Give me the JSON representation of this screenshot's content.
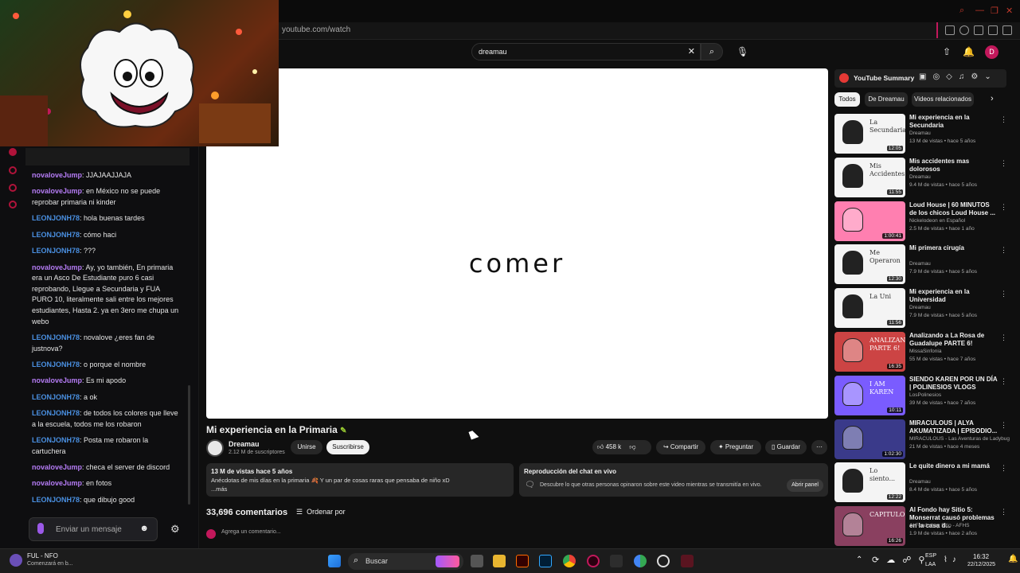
{
  "browser": {
    "url": "youtube.com/watch"
  },
  "youtube": {
    "search_query": "dreamau",
    "avatar_letter": "D",
    "player_word": "comer",
    "video_title": "Mi experiencia en la Primaria",
    "channel_name": "Dreamau",
    "channel_subs": "2.12 M de suscriptores",
    "join_label": "Unirse",
    "subscribe_label": "Suscribirse",
    "likes": "458 k",
    "share_label": "Compartir",
    "ask_label": "Preguntar",
    "save_label": "Guardar",
    "desc_stats": "13 M de vistas  hace 5 años",
    "desc_text": "Anécdotas de mis días en la primaria 🍂 Y un par de cosas raras que pensaba de niño xD",
    "desc_more": "...más",
    "live_title": "Reproducción del chat en vivo",
    "live_desc": "Descubre lo que otras personas opinaron sobre este video mientras se transmitía en vivo.",
    "live_button": "Abrir panel",
    "comment_count": "33,696 comentarios",
    "order_label": "Ordenar por",
    "add_comment_placeholder": "Agrega un comentario..."
  },
  "sidebar": {
    "summary_title": "YouTube Summary",
    "chips": [
      "Todos",
      "De Dreamau",
      "Videos relacionados"
    ],
    "videos": [
      {
        "title": "Mi experiencia en la Secundaria",
        "channel": "Dreamau",
        "views": "13 M de vistas • hace 5 años",
        "duration": "12:05",
        "thumb_text": "La Secundaria"
      },
      {
        "title": "Mis accidentes mas dolorosos",
        "channel": "Dreamau",
        "views": "9.4 M de vistas • hace 5 años",
        "duration": "11:55",
        "thumb_text": "Mis Accidentes"
      },
      {
        "title": "Loud House | 60 MINUTOS de los chicos Loud House ...",
        "channel": "Nickelodeon en Español",
        "views": "2.5 M de vistas • hace 1 año",
        "duration": "1:00:41",
        "thumb_text": ""
      },
      {
        "title": "Mi primera cirugía",
        "channel": "Dreamau",
        "views": "7.9 M de vistas • hace 5 años",
        "duration": "12:30",
        "thumb_text": "Me Operaron"
      },
      {
        "title": "Mi experiencia en la Universidad",
        "channel": "Dreamau",
        "views": "7.9 M de vistas • hace 5 años",
        "duration": "11:56",
        "thumb_text": "La Uni"
      },
      {
        "title": "Analizando a La Rosa de Guadalupe PARTE 6!",
        "channel": "MissaSinfonia",
        "views": "55 M de vistas • hace 7 años",
        "duration": "16:35",
        "thumb_text": "ANALIZANDO PARTE 6!"
      },
      {
        "title": "SIENDO KAREN POR UN DÍA | POLINESIOS VLOGS",
        "channel": "LosPolinesios",
        "views": "39 M de vistas • hace 7 años",
        "duration": "10:11",
        "thumb_text": "I AM KAREN"
      },
      {
        "title": "MIRACULOUS | ALYA AKUMATIZADA | EPISODIO...",
        "channel": "MIRACULOUS - Las Aventuras de Ladybug",
        "views": "21 M de vistas • hace 4 meses",
        "duration": "1:02:30",
        "thumb_text": ""
      },
      {
        "title": "Le quite dinero a mi mamá",
        "channel": "Dreamau",
        "views": "8.4 M de vistas • hace 5 años",
        "duration": "12:22",
        "thumb_text": "Lo siento..."
      },
      {
        "title": "Al Fondo hay Sitio 5: Monserrat causó problemas en la casa d...",
        "channel": "Al Fondo hay Sitio - AFHS",
        "views": "1.9 M de vistas • hace 2 años",
        "duration": "16:26",
        "thumb_text": "CAPITULO"
      }
    ]
  },
  "chat": {
    "messages": [
      {
        "user": "novaloveJump",
        "text": "JJAJAAJJAJA",
        "color": "#b57cf5"
      },
      {
        "user": "novaloveJump",
        "text": "en México no se puede reprobar primaria ni kinder",
        "color": "#b57cf5"
      },
      {
        "user": "LEONJONH78",
        "text": "hola buenas tardes",
        "color": "#4a90e2"
      },
      {
        "user": "LEONJONH78",
        "text": "cómo haci",
        "color": "#4a90e2"
      },
      {
        "user": "LEONJONH78",
        "text": "???",
        "color": "#4a90e2"
      },
      {
        "user": "novaloveJump",
        "text": "Ay, yo también, En primaria era un Asco De Estudiante puro 6 casi reprobando, Llegue a Secundaria y FUA PURO 10, literalmente sali entre los mejores estudiantes, Hasta 2. ya en 3ero me chupa un webo",
        "color": "#b57cf5"
      },
      {
        "user": "LEONJONH78",
        "text": "novalove ¿eres fan de justnova?",
        "color": "#4a90e2"
      },
      {
        "user": "LEONJONH78",
        "text": "o porque el nombre",
        "color": "#4a90e2"
      },
      {
        "user": "novaloveJump",
        "text": "Es mi apodo",
        "color": "#b57cf5"
      },
      {
        "user": "LEONJONH78",
        "text": "a ok",
        "color": "#4a90e2"
      },
      {
        "user": "LEONJONH78",
        "text": "de todos los colores que lleve a la escuela, todos me los robaron",
        "color": "#4a90e2"
      },
      {
        "user": "LEONJONH78",
        "text": "Posta me robaron la cartuchera",
        "color": "#4a90e2"
      },
      {
        "user": "novaloveJump",
        "text": "checa el server de discord",
        "color": "#b57cf5"
      },
      {
        "user": "novaloveJump",
        "text": "en fotos",
        "color": "#b57cf5"
      },
      {
        "user": "LEONJONH78",
        "text": "que dibujo good",
        "color": "#4a90e2"
      }
    ],
    "input_placeholder": "Enviar un mensaje"
  },
  "taskbar": {
    "weather_title": "FUL - NFO",
    "weather_sub": "Comenzará en b...",
    "search_label": "Buscar",
    "lang": "ESP",
    "lang_sub": "LAA",
    "time": "16:32",
    "date": "22/12/2025"
  }
}
